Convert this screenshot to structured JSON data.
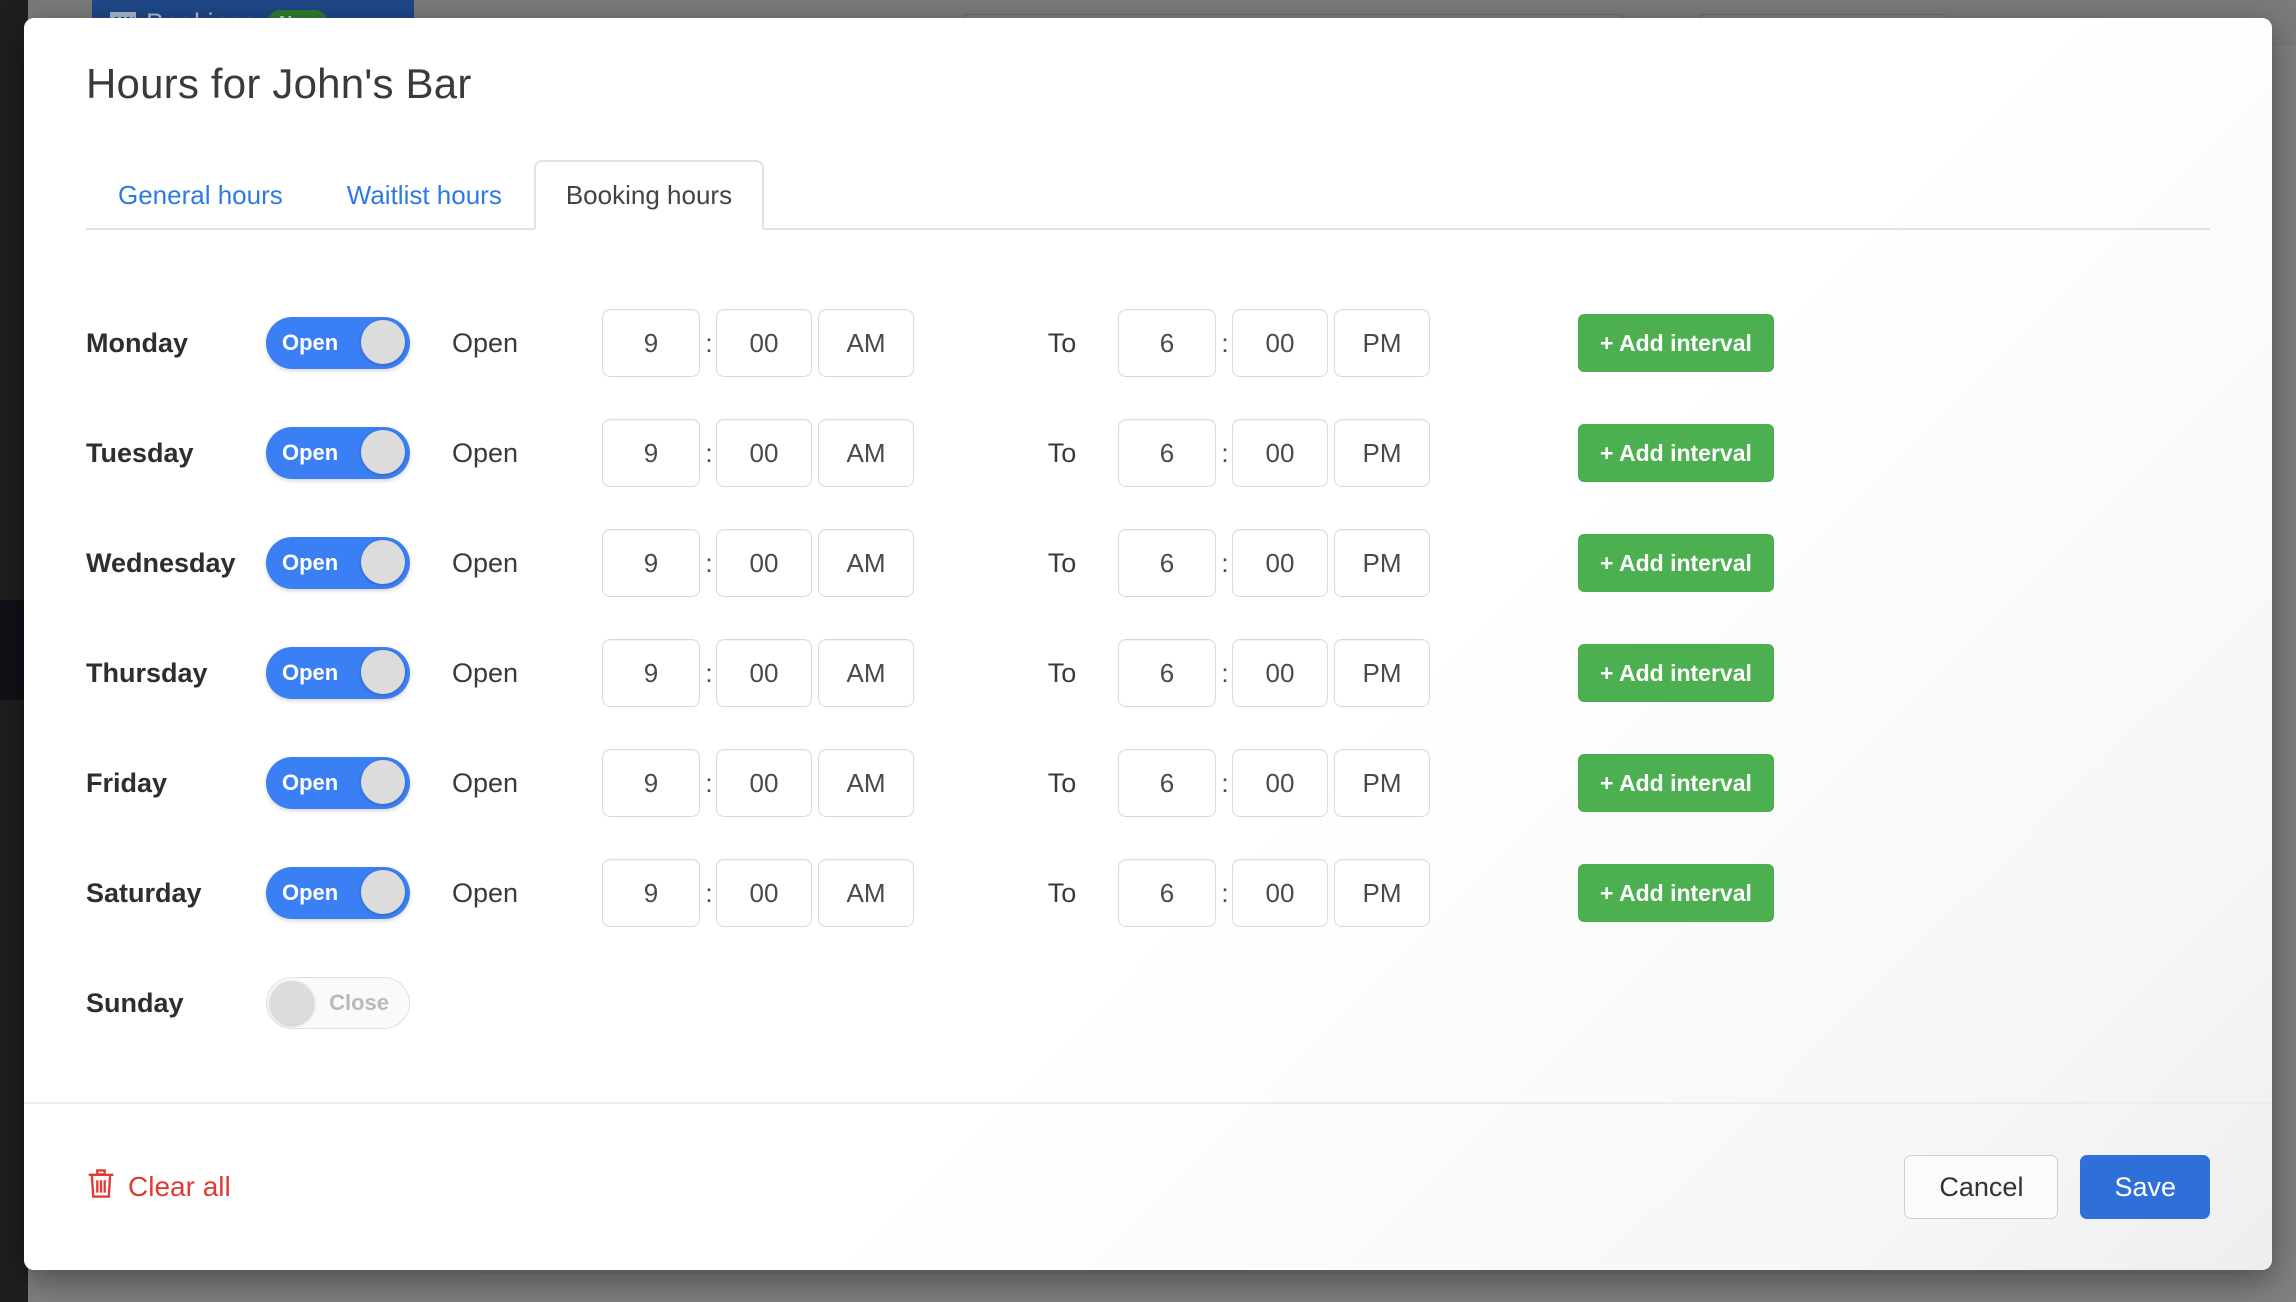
{
  "background": {
    "nav_tab_label": "Bookings",
    "nav_tab_badge": "New",
    "nav_icon": "grid-calendar-icon"
  },
  "modal": {
    "title": "Hours for John's Bar",
    "tabs": [
      {
        "label": "General hours",
        "active": false
      },
      {
        "label": "Waitlist hours",
        "active": false
      },
      {
        "label": "Booking hours",
        "active": true
      }
    ],
    "column_words": {
      "open_word": "Open",
      "to_word": "To"
    },
    "add_interval_label": "+ Add interval",
    "toggle_on_label": "Open",
    "toggle_off_label": "Close",
    "rows": [
      {
        "day": "Monday",
        "state": "Open",
        "open": true,
        "from_hour": "9",
        "from_minute": "00",
        "from_meridiem": "AM",
        "to_hour": "6",
        "to_minute": "00",
        "to_meridiem": "PM"
      },
      {
        "day": "Tuesday",
        "state": "Open",
        "open": true,
        "from_hour": "9",
        "from_minute": "00",
        "from_meridiem": "AM",
        "to_hour": "6",
        "to_minute": "00",
        "to_meridiem": "PM"
      },
      {
        "day": "Wednesday",
        "state": "Open",
        "open": true,
        "from_hour": "9",
        "from_minute": "00",
        "from_meridiem": "AM",
        "to_hour": "6",
        "to_minute": "00",
        "to_meridiem": "PM"
      },
      {
        "day": "Thursday",
        "state": "Open",
        "open": true,
        "from_hour": "9",
        "from_minute": "00",
        "from_meridiem": "AM",
        "to_hour": "6",
        "to_minute": "00",
        "to_meridiem": "PM"
      },
      {
        "day": "Friday",
        "state": "Open",
        "open": true,
        "from_hour": "9",
        "from_minute": "00",
        "from_meridiem": "AM",
        "to_hour": "6",
        "to_minute": "00",
        "to_meridiem": "PM"
      },
      {
        "day": "Saturday",
        "state": "Open",
        "open": true,
        "from_hour": "9",
        "from_minute": "00",
        "from_meridiem": "AM",
        "to_hour": "6",
        "to_minute": "00",
        "to_meridiem": "PM"
      },
      {
        "day": "Sunday",
        "state": "Close",
        "open": false
      }
    ],
    "footer": {
      "clear_all_label": "Clear all",
      "clear_all_icon": "trash-icon",
      "cancel_label": "Cancel",
      "save_label": "Save"
    }
  },
  "colors": {
    "toggle_on": "#3b7ff5",
    "add_interval": "#4caf50",
    "save": "#2f70d8",
    "clear_all": "#e03a34",
    "tab_link": "#2c7be5",
    "nav_tab": "#1f4788"
  }
}
